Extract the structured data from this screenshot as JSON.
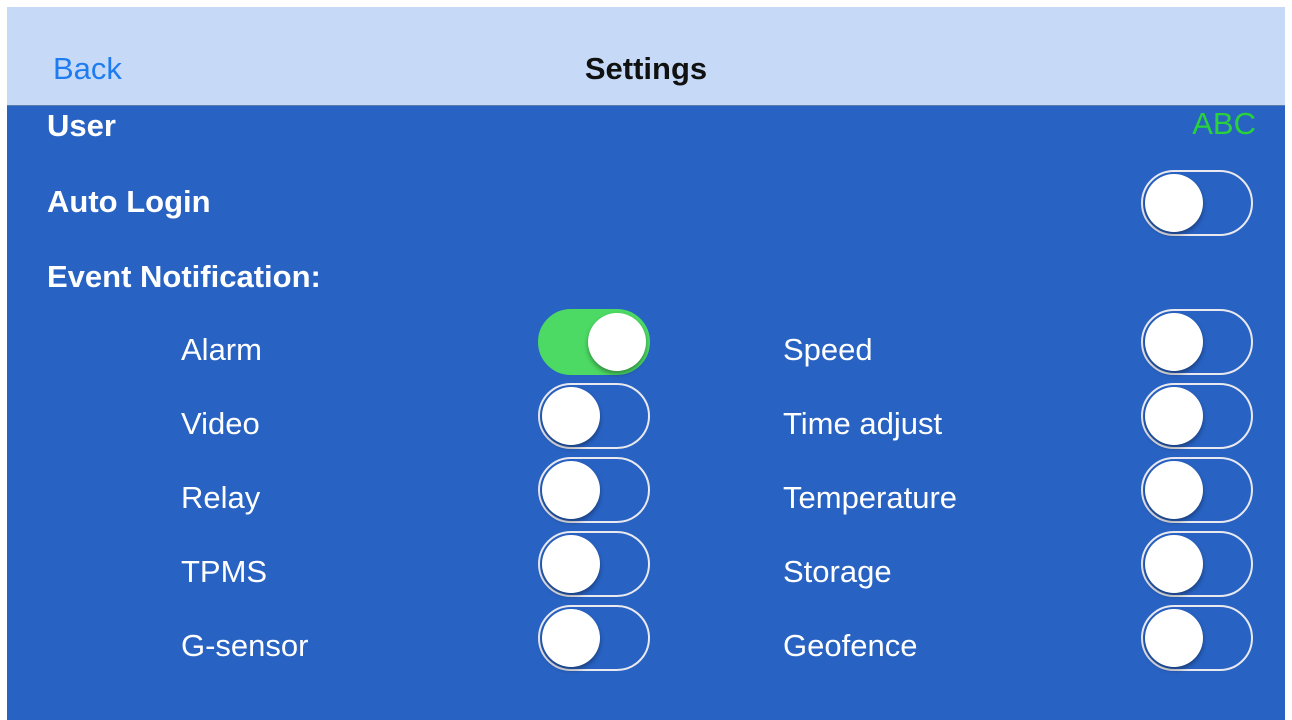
{
  "nav": {
    "back_label": "Back",
    "title": "Settings"
  },
  "user": {
    "label": "User",
    "value": "ABC"
  },
  "auto_login": {
    "label": "Auto Login",
    "on": false
  },
  "event_notification": {
    "heading": "Event Notification:",
    "left": [
      {
        "label": "Alarm",
        "on": true
      },
      {
        "label": "Video",
        "on": false
      },
      {
        "label": "Relay",
        "on": false
      },
      {
        "label": "TPMS",
        "on": false
      },
      {
        "label": "G-sensor",
        "on": false
      }
    ],
    "right": [
      {
        "label": "Speed",
        "on": false
      },
      {
        "label": "Time adjust",
        "on": false
      },
      {
        "label": "Temperature",
        "on": false
      },
      {
        "label": "Storage",
        "on": false
      },
      {
        "label": "Geofence",
        "on": false
      }
    ]
  },
  "colors": {
    "navbar_bg": "#c6daf8",
    "content_bg": "#2862c3",
    "back_link": "#1f7cf0",
    "user_value": "#28d23a",
    "toggle_on": "#4cd964"
  }
}
